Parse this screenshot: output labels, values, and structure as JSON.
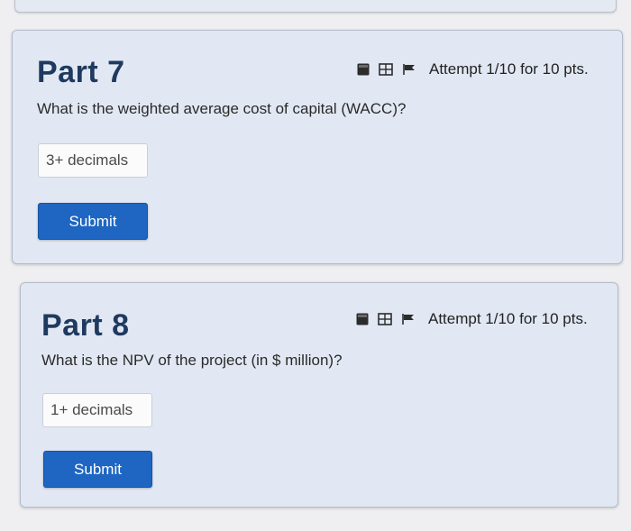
{
  "parts": [
    {
      "title": "Part 7",
      "question": "What is the weighted average cost of capital (WACC)?",
      "input_placeholder": "3+ decimals",
      "input_value": "",
      "submit_label": "Submit",
      "attempt_text": "Attempt 1/10 for 10 pts.",
      "icons": [
        "calculator-icon",
        "notes-icon",
        "flag-icon"
      ]
    },
    {
      "title": "Part 8",
      "question": "What is the NPV of the project (in $ million)?",
      "input_placeholder": "1+ decimals",
      "input_value": "",
      "submit_label": "Submit",
      "attempt_text": "Attempt 1/10 for 10 pts.",
      "icons": [
        "calculator-icon",
        "notes-icon",
        "flag-icon"
      ]
    }
  ],
  "colors": {
    "title": "#1f3a5f",
    "submit_bg": "#1e66c2",
    "card_bg": "#e2e8f3"
  }
}
